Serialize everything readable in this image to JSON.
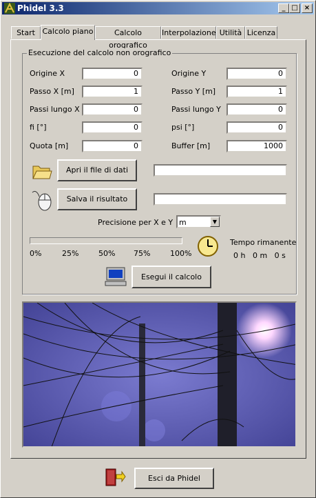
{
  "window": {
    "title": "Phidel 3.3"
  },
  "tabs": [
    {
      "label": "Start"
    },
    {
      "label": "Calcolo piano"
    },
    {
      "label": "Calcolo orografico"
    },
    {
      "label": "Interpolazione"
    },
    {
      "label": "Utilità"
    },
    {
      "label": "Licenza"
    }
  ],
  "active_tab": "Calcolo piano",
  "group": {
    "title": "Esecuzione del calcolo non orografico"
  },
  "fields": {
    "origine_x": {
      "label": "Origine X",
      "value": "0"
    },
    "origine_y": {
      "label": "Origine Y",
      "value": "0"
    },
    "passo_x": {
      "label": "Passo X [m]",
      "value": "1"
    },
    "passo_y": {
      "label": "Passo Y [m]",
      "value": "1"
    },
    "passi_lungo_x": {
      "label": "Passi lungo X",
      "value": "0"
    },
    "passi_lungo_y": {
      "label": "Passi lungo Y",
      "value": "0"
    },
    "fi": {
      "label": "fi [°]",
      "value": "0"
    },
    "psi": {
      "label": "psi [°]",
      "value": "0"
    },
    "quota": {
      "label": "Quota [m]",
      "value": "0"
    },
    "buffer": {
      "label": "Buffer [m]",
      "value": "1000"
    }
  },
  "actions": {
    "open_label": "Apri il file di dati",
    "open_path": "",
    "save_label": "Salva il risultato",
    "save_path": "",
    "run_label": "Esegui il calcolo",
    "exit_label": "Esci da Phidel"
  },
  "precision": {
    "label": "Precisione per X e Y",
    "selected": "m"
  },
  "progress": {
    "value_percent": 0,
    "ticks": [
      "0%",
      "25%",
      "50%",
      "75%",
      "100%"
    ],
    "remaining_label": "Tempo rimanente",
    "remaining_value": "0 h   0 m   0 s"
  },
  "icons": {
    "folder": "folder-icon",
    "mouse": "mouse-icon",
    "clock": "clock-icon",
    "computer": "computer-icon",
    "exit": "exit-door-icon"
  }
}
